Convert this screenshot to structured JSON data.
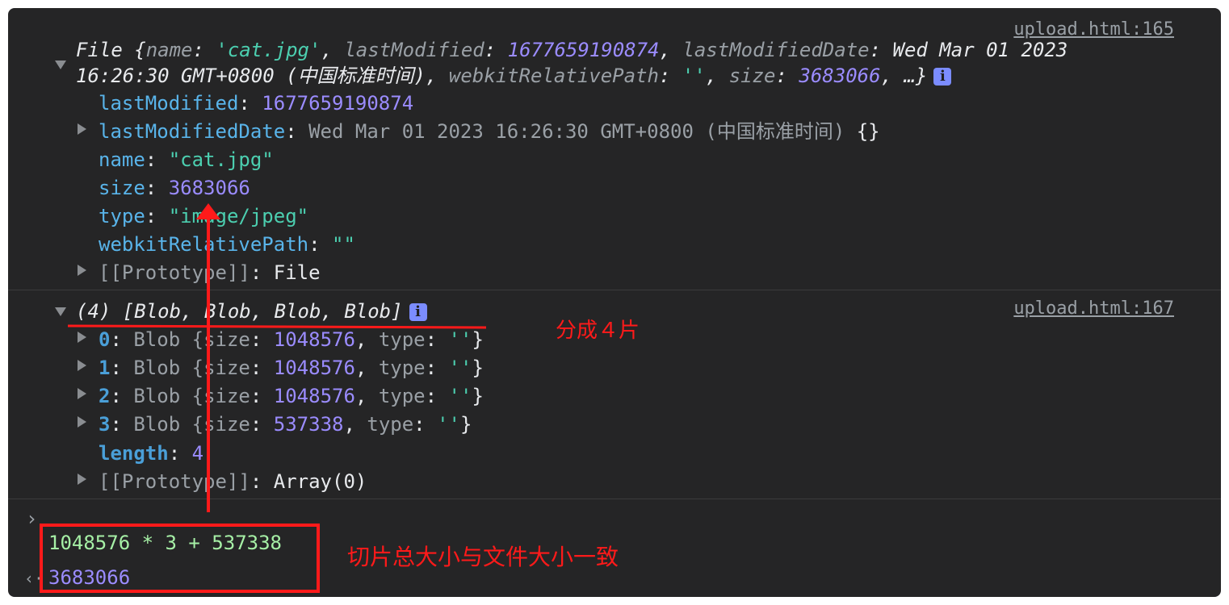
{
  "log1": {
    "source": "upload.html:165",
    "summary_prefix": "File {",
    "summary_line1": [
      {
        "t": "name",
        "c": "k"
      },
      {
        "t": ": ",
        "c": "w"
      },
      {
        "t": "'cat.jpg'",
        "c": "str"
      },
      {
        "t": ", ",
        "c": "w"
      },
      {
        "t": "lastModified",
        "c": "k"
      },
      {
        "t": ": ",
        "c": "w"
      },
      {
        "t": "1677659190874",
        "c": "num"
      },
      {
        "t": ", ",
        "c": "w"
      },
      {
        "t": "lastModifiedDate",
        "c": "k"
      },
      {
        "t": ": ",
        "c": "w"
      },
      {
        "t": "Wed Mar 01 2023",
        "c": "w"
      }
    ],
    "summary_line2": [
      {
        "t": "16:26:30 GMT+0800 (中国标准时间)",
        "c": "w"
      },
      {
        "t": ", ",
        "c": "w"
      },
      {
        "t": "webkitRelativePath",
        "c": "k"
      },
      {
        "t": ": ",
        "c": "w"
      },
      {
        "t": "''",
        "c": "str"
      },
      {
        "t": ", ",
        "c": "w"
      },
      {
        "t": "size",
        "c": "k"
      },
      {
        "t": ": ",
        "c": "w"
      },
      {
        "t": "3683066",
        "c": "num"
      },
      {
        "t": ", …}",
        "c": "w"
      }
    ],
    "props": [
      {
        "key": "lastModified",
        "value": "1677659190874",
        "kind": "num",
        "expand": false
      },
      {
        "key": "lastModifiedDate",
        "value": "Wed Mar 01 2023 16:26:30 GMT+0800 (中国标准时间)",
        "kind": "date",
        "suffix": " {}",
        "expand": true
      },
      {
        "key": "name",
        "value": "\"cat.jpg\"",
        "kind": "str",
        "expand": false
      },
      {
        "key": "size",
        "value": "3683066",
        "kind": "num",
        "expand": false
      },
      {
        "key": "type",
        "value": "\"image/jpeg\"",
        "kind": "str",
        "expand": false
      },
      {
        "key": "webkitRelativePath",
        "value": "\"\"",
        "kind": "str",
        "expand": false
      }
    ],
    "prototype": {
      "key": "[[Prototype]]",
      "value": "File"
    }
  },
  "log2": {
    "source": "upload.html:167",
    "summary": "(4) [Blob, Blob, Blob, Blob]",
    "items": [
      {
        "index": "0",
        "type_name": "Blob",
        "size": "1048576",
        "type": "''"
      },
      {
        "index": "1",
        "type_name": "Blob",
        "size": "1048576",
        "type": "''"
      },
      {
        "index": "2",
        "type_name": "Blob",
        "size": "1048576",
        "type": "''"
      },
      {
        "index": "3",
        "type_name": "Blob",
        "size": "537338",
        "type": "''"
      }
    ],
    "length": {
      "key": "length",
      "value": "4"
    },
    "prototype": {
      "key": "[[Prototype]]",
      "value": "Array(0)"
    }
  },
  "console": {
    "prompt_glyph": "›",
    "input": "1048576 * 3 + 537338",
    "result_glyph": "‹·",
    "result": "3683066"
  },
  "annotations": {
    "split_label": "分成４片",
    "sum_label": "切片总大小与文件大小一致"
  },
  "colors": {
    "background": "#252526",
    "key": "#9aa0a6",
    "key_blue": "#59b4ea",
    "string": "#4ccfb0",
    "number": "#9b8cff",
    "input": "#a6f0a6",
    "annotation": "#ff1a1a"
  }
}
